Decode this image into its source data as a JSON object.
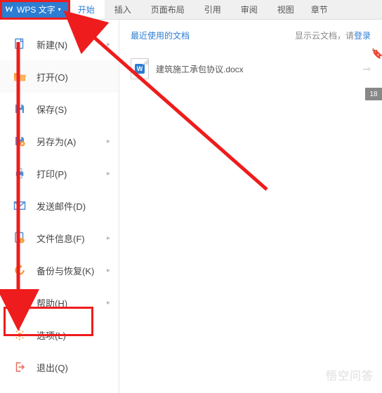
{
  "app": {
    "name": "WPS 文字"
  },
  "tabs": {
    "items": [
      {
        "label": "开始",
        "active": true
      },
      {
        "label": "插入"
      },
      {
        "label": "页面布局"
      },
      {
        "label": "引用"
      },
      {
        "label": "审阅"
      },
      {
        "label": "视图"
      },
      {
        "label": "章节",
        "partial": true
      }
    ]
  },
  "sidebar": {
    "items": [
      {
        "label": "新建(N)",
        "icon": "new-file-icon",
        "chev": true
      },
      {
        "label": "打开(O)",
        "icon": "open-folder-icon",
        "active": true
      },
      {
        "label": "保存(S)",
        "icon": "save-icon"
      },
      {
        "label": "另存为(A)",
        "icon": "save-as-icon",
        "chev": true
      },
      {
        "label": "打印(P)",
        "icon": "print-icon",
        "chev": true
      },
      {
        "label": "发送邮件(D)",
        "icon": "mail-icon"
      },
      {
        "label": "文件信息(F)",
        "icon": "file-info-icon",
        "chev": true
      },
      {
        "label": "备份与恢复(K)",
        "icon": "backup-icon",
        "chev": true
      },
      {
        "label": "帮助(H)",
        "icon": "help-icon",
        "chev": true
      },
      {
        "label": "选项(L)",
        "icon": "options-icon"
      },
      {
        "label": "退出(Q)",
        "icon": "exit-icon"
      }
    ]
  },
  "content": {
    "recent_title": "最近使用的文档",
    "cloud_prefix": "显示云文档，请",
    "cloud_link": "登录",
    "doc_name": "建筑施工承包协议.docx"
  },
  "rightedge": {
    "label": "18"
  },
  "watermark": "悟空问答"
}
